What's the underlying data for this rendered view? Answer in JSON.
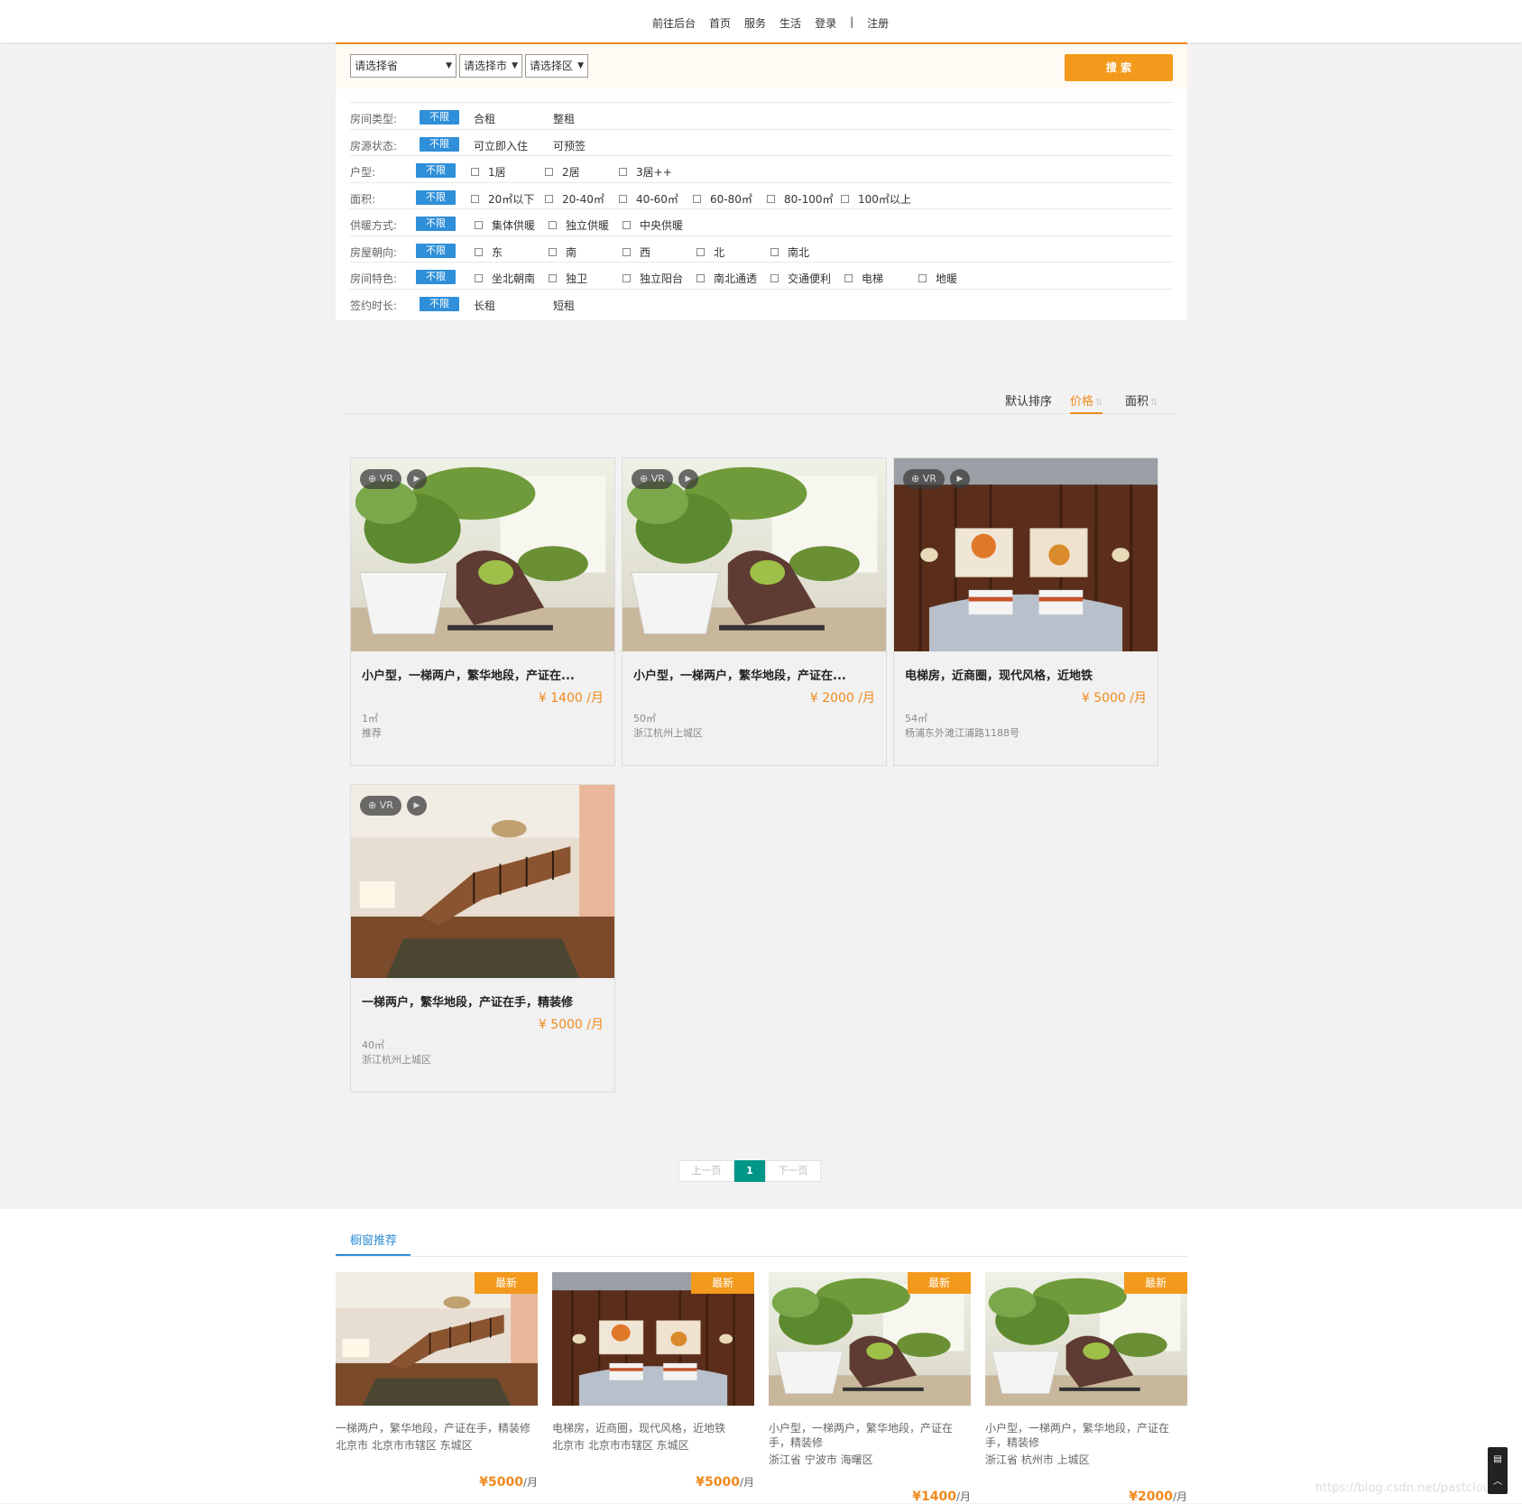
{
  "nav": [
    "前往后台",
    "首页",
    "服务",
    "生活",
    "登录",
    "|",
    "注册"
  ],
  "search": {
    "province": "请选择省",
    "city": "请选择市",
    "district": "请选择区",
    "button": "搜 索"
  },
  "filters": [
    {
      "label": "房间类型:",
      "any": "不限",
      "checkbox": false,
      "options": [
        "合租",
        "整租"
      ]
    },
    {
      "label": "房源状态:",
      "any": "不限",
      "checkbox": false,
      "options": [
        "可立即入住",
        "可预签"
      ]
    },
    {
      "label": "户型:",
      "any": "不限",
      "checkbox": true,
      "options": [
        "1居",
        "2居",
        "3居++"
      ]
    },
    {
      "label": "面积:",
      "any": "不限",
      "checkbox": true,
      "options": [
        "20㎡以下",
        "20-40㎡",
        "40-60㎡",
        "60-80㎡",
        "80-100㎡",
        "100㎡以上"
      ]
    },
    {
      "label": "供暖方式:",
      "any": "不限",
      "checkbox": true,
      "options": [
        "集体供暖",
        "独立供暖",
        "中央供暖"
      ]
    },
    {
      "label": "房屋朝向:",
      "any": "不限",
      "checkbox": true,
      "options": [
        "东",
        "南",
        "西",
        "北",
        "南北"
      ]
    },
    {
      "label": "房间特色:",
      "any": "不限",
      "checkbox": true,
      "options": [
        "坐北朝南",
        "独卫",
        "独立阳台",
        "南北通透",
        "交通便利",
        "电梯",
        "地暖"
      ]
    },
    {
      "label": "签约时长:",
      "any": "不限",
      "checkbox": false,
      "options": [
        "长租",
        "短租"
      ]
    }
  ],
  "sort": {
    "default": "默认排序",
    "price": "价格",
    "area": "面积",
    "arrow": "⇅"
  },
  "badges": {
    "vr": "VR",
    "play": "▶"
  },
  "listings": [
    {
      "title": "小户型，一梯两户，繁华地段，产证在...",
      "price": "¥  1400 /月",
      "area": "1㎡",
      "loc": "推荐",
      "img": "plant"
    },
    {
      "title": "小户型，一梯两户，繁华地段，产证在...",
      "price": "¥  2000 /月",
      "area": "50㎡",
      "loc": "浙江杭州上城区",
      "img": "plant"
    },
    {
      "title": "电梯房，近商圈，现代风格，近地铁",
      "price": "¥  5000 /月",
      "area": "54㎡",
      "loc": "杨浦东外滩江浦路1188号",
      "img": "bedroom"
    },
    {
      "title": "一梯两户，繁华地段，产证在手，精装修",
      "price": "¥  5000 /月",
      "area": "40㎡",
      "loc": "浙江杭州上城区",
      "img": "stairs"
    }
  ],
  "pager": {
    "prev": "上一页",
    "current": "1",
    "next": "下一页"
  },
  "recommend": {
    "tab": "橱窗推荐",
    "new_label": "最新",
    "items": [
      {
        "title": "一梯两户，繁华地段，产证在手，精装修",
        "loc": "北京市 北京市市辖区 东城区",
        "price": "¥5000",
        "unit": "/月",
        "img": "stairs"
      },
      {
        "title": "电梯房，近商圈，现代风格，近地铁",
        "loc": "北京市 北京市市辖区 东城区",
        "price": "¥5000",
        "unit": "/月",
        "img": "bedroom"
      },
      {
        "title": "小户型，一梯两户，繁华地段，产证在手，精装修",
        "loc": "浙江省 宁波市 海曙区",
        "price": "¥1400",
        "unit": "/月",
        "img": "plant"
      },
      {
        "title": "小户型，一梯两户，繁华地段，产证在手，精装修",
        "loc": "浙江省 杭州市 上城区",
        "price": "¥2000",
        "unit": "/月",
        "img": "plant"
      }
    ]
  },
  "watermark": "https://blog.csdn.net/pastclouds"
}
